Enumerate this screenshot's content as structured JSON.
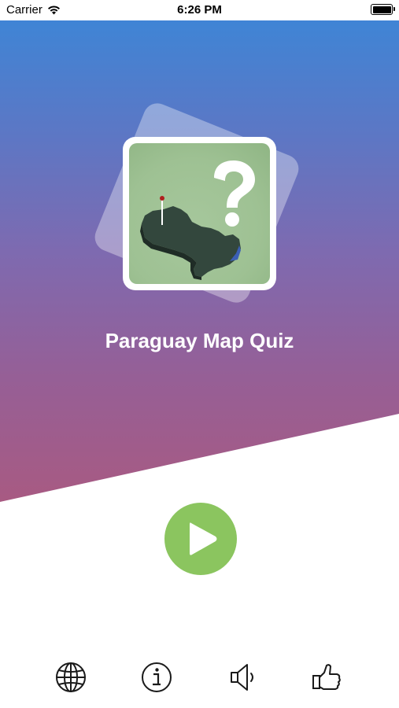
{
  "status_bar": {
    "carrier": "Carrier",
    "time": "6:26 PM"
  },
  "app": {
    "title": "Paraguay Map Quiz"
  },
  "colors": {
    "gradient_top": "#3a87d8",
    "gradient_bottom": "#a85a82",
    "play_green": "#8bc55f",
    "logo_map_bg": "#9ec193"
  },
  "icons": {
    "play": "play-icon",
    "globe": "globe-icon",
    "info": "info-icon",
    "sound": "speaker-icon",
    "like": "thumbs-up-icon"
  }
}
